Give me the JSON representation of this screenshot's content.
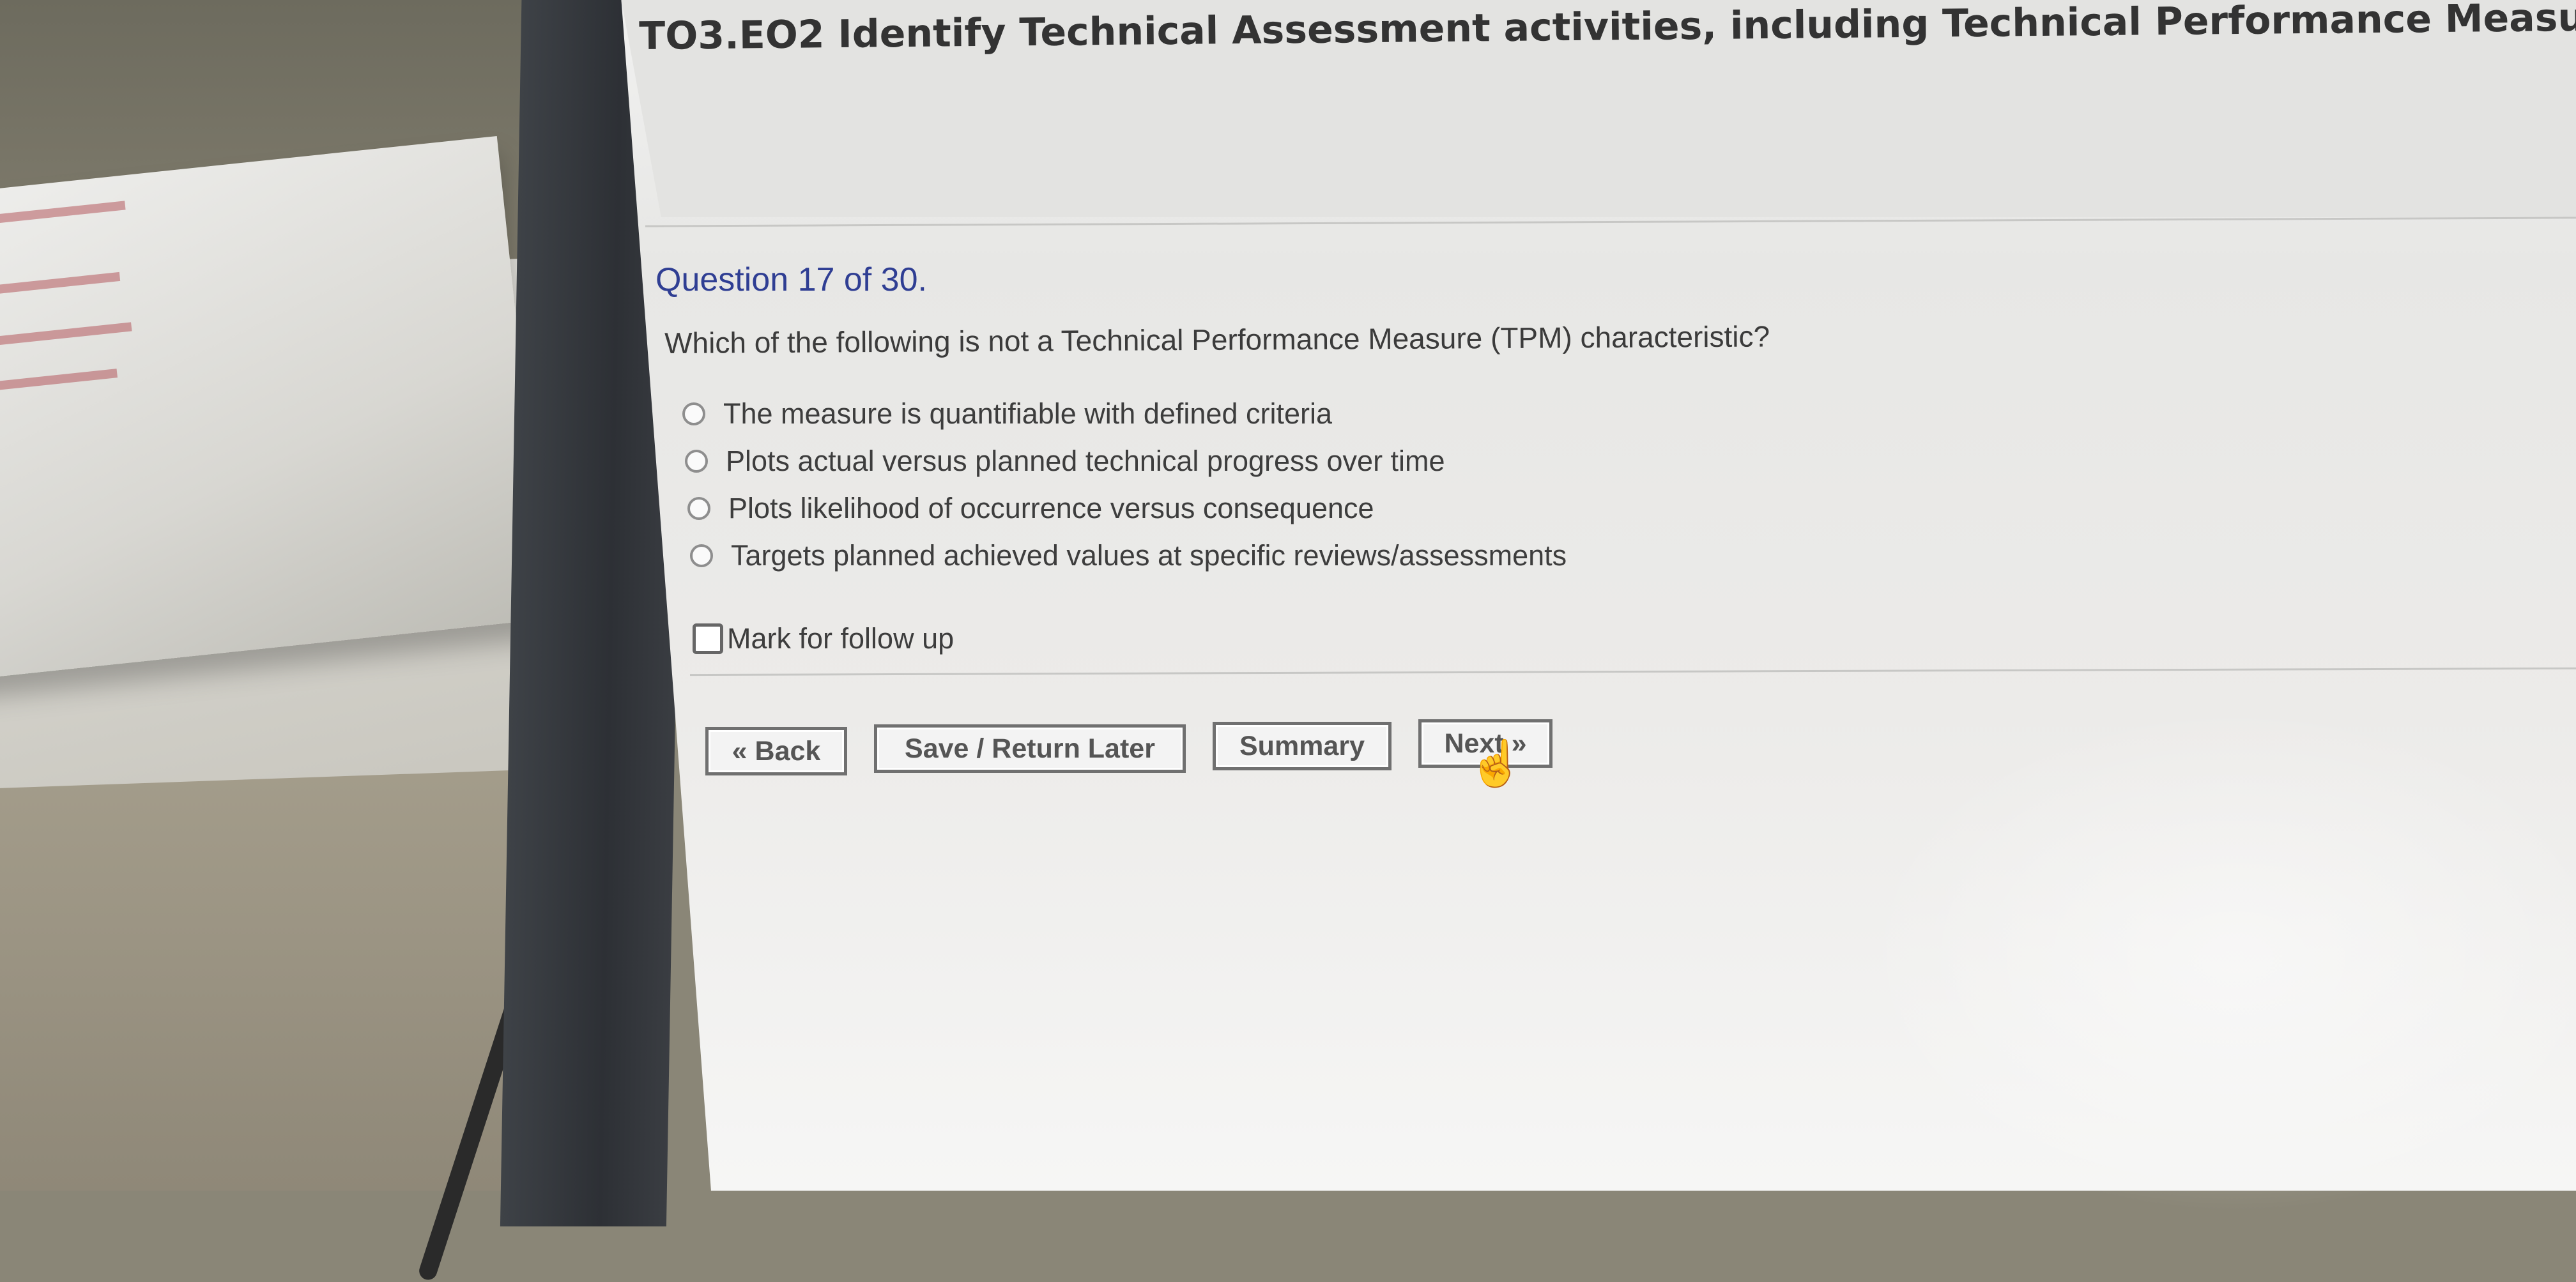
{
  "page_title": "TO3.EO2 Identify Technical Assessment activities, including Technical Performance Measures",
  "question": {
    "counter": "Question 17 of 30.",
    "text": "Which of the following is not a Technical Performance Measure (TPM) characteristic?",
    "options": [
      "The measure is quantifiable with defined criteria",
      "Plots actual versus planned technical progress over time",
      "Plots likelihood of occurrence versus consequence",
      "Targets planned achieved values at specific reviews/assessments"
    ]
  },
  "follow_up": {
    "label": "Mark for follow up",
    "checked": false
  },
  "buttons": {
    "back": "« Back",
    "save_return": "Save / Return Later",
    "summary": "Summary",
    "next": "Next »"
  },
  "colors": {
    "question_counter": "#2f3e93",
    "text": "#3b3b3b",
    "button_border": "#707070"
  },
  "icons": {
    "cursor": "hand-pointer-icon"
  }
}
